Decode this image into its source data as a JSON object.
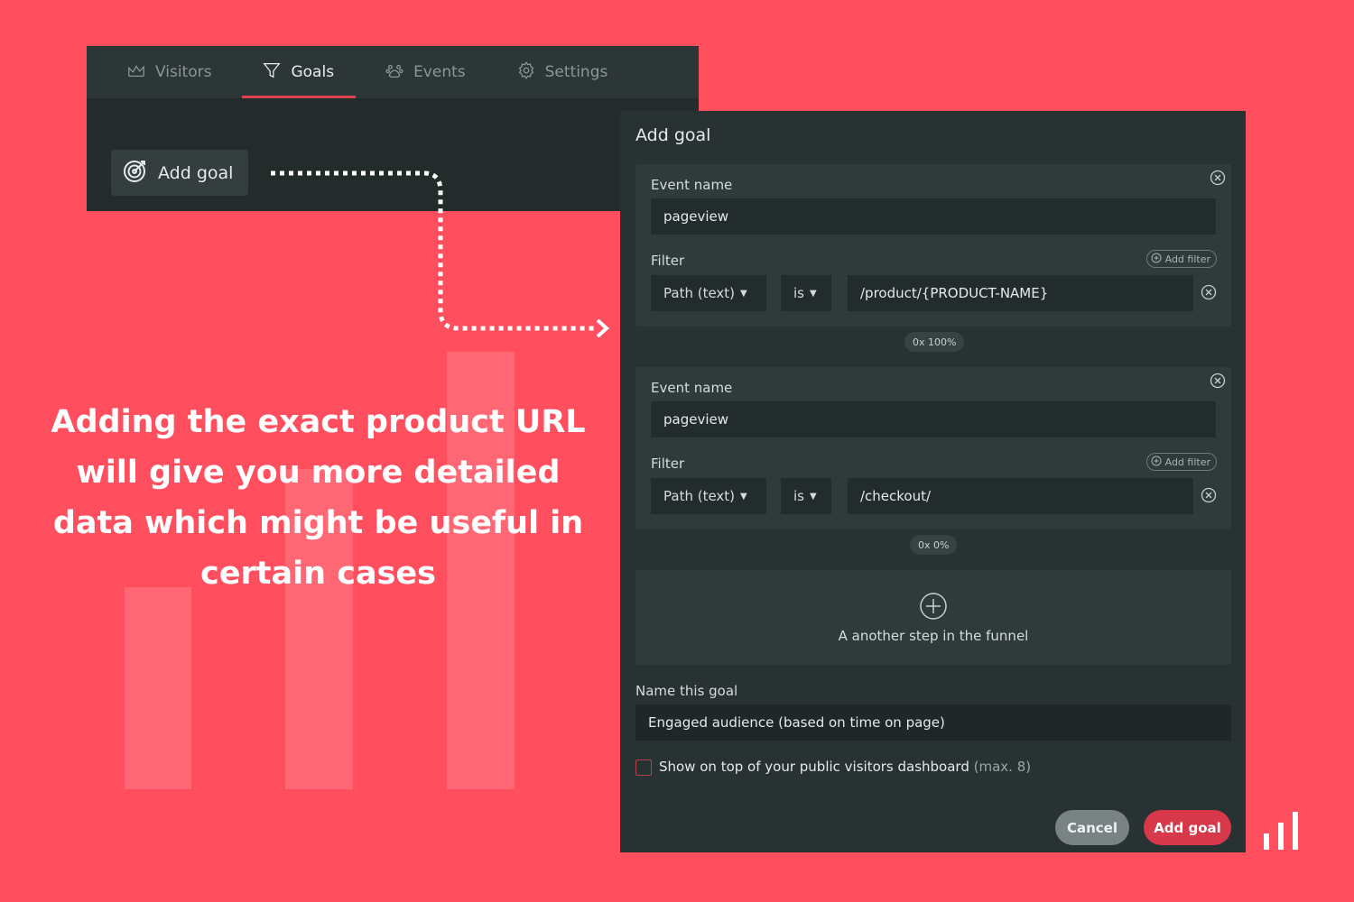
{
  "nav": {
    "tabs": [
      {
        "label": "Visitors",
        "icon": "mountain-chart-icon",
        "active": false
      },
      {
        "label": "Goals",
        "icon": "funnel-icon",
        "active": true
      },
      {
        "label": "Events",
        "icon": "paw-icon",
        "active": false
      },
      {
        "label": "Settings",
        "icon": "gear-icon",
        "active": false
      }
    ],
    "add_goal_label": "Add goal"
  },
  "caption": "Adding the exact product URL will give you more detailed data which might be useful in certain cases",
  "modal": {
    "title": "Add goal",
    "steps": [
      {
        "event_label": "Event name",
        "event_value": "pageview",
        "filter_label": "Filter",
        "add_filter_label": "Add filter",
        "filter_field": "Path (text)",
        "filter_operator": "is",
        "filter_value": "/product/{PRODUCT-NAME}",
        "conversion": "0x 100%"
      },
      {
        "event_label": "Event name",
        "event_value": "pageview",
        "filter_label": "Filter",
        "add_filter_label": "Add filter",
        "filter_field": "Path (text)",
        "filter_operator": "is",
        "filter_value": "/checkout/",
        "conversion": "0x 0%"
      }
    ],
    "add_step_label": "A another step in the funnel",
    "goal_name_label": "Name this goal",
    "goal_name_value": "Engaged audience (based on time on page)",
    "show_on_top_label": "Show on top of your public visitors dashboard",
    "show_on_top_hint": "(max. 8)",
    "cancel_label": "Cancel",
    "submit_label": "Add goal"
  },
  "colors": {
    "background": "#FF4F5E",
    "panel": "#283232",
    "accent": "#D8394A"
  }
}
